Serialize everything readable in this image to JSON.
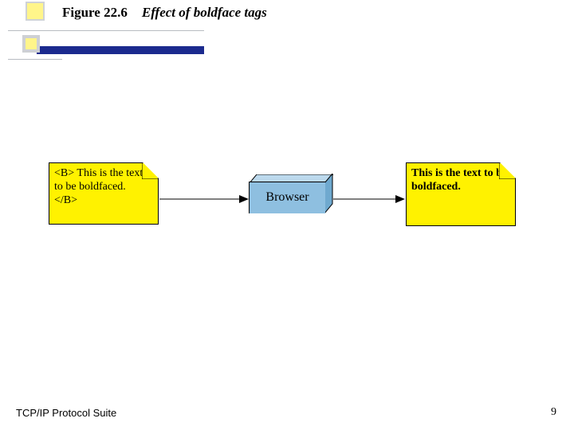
{
  "header": {
    "figure_number": "Figure 22.6",
    "figure_caption": "Effect of boldface tags"
  },
  "diagram": {
    "left_note": {
      "open_tag": "<B>",
      "body": " This is the text to be boldfaced. ",
      "close_tag": "</B>"
    },
    "browser_label": "Browser",
    "right_note": {
      "text": "This is the text to be boldfaced."
    }
  },
  "footer": {
    "left": "TCP/IP Protocol Suite",
    "page_number": "9"
  }
}
